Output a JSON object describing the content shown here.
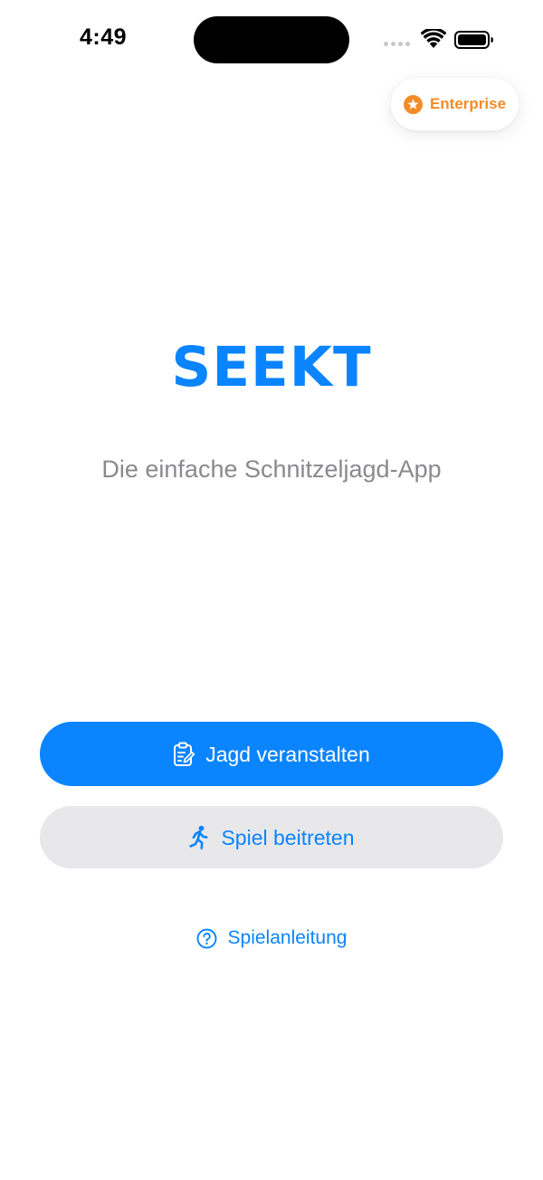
{
  "status_bar": {
    "time": "4:49",
    "icons": [
      "cellular-signal-icon",
      "wifi-icon",
      "battery-icon"
    ]
  },
  "enterprise_badge": {
    "label": "Enterprise",
    "icon": "star-icon",
    "color": "#f28c28"
  },
  "brand": {
    "logo_text": "SEEKT",
    "tagline": "Die einfache Schnitzeljagd-App",
    "color": "#0a84ff"
  },
  "actions": {
    "host_hunt": {
      "label": "Jagd veranstalten",
      "icon": "clipboard-edit-icon"
    },
    "join_game": {
      "label": "Spiel beitreten",
      "icon": "running-person-icon"
    },
    "instructions": {
      "label": "Spielanleitung",
      "icon": "question-circle-icon"
    }
  },
  "colors": {
    "accent": "#0a84ff",
    "secondary_button_bg": "#e8e8ea",
    "tagline": "#8a8a8e"
  }
}
